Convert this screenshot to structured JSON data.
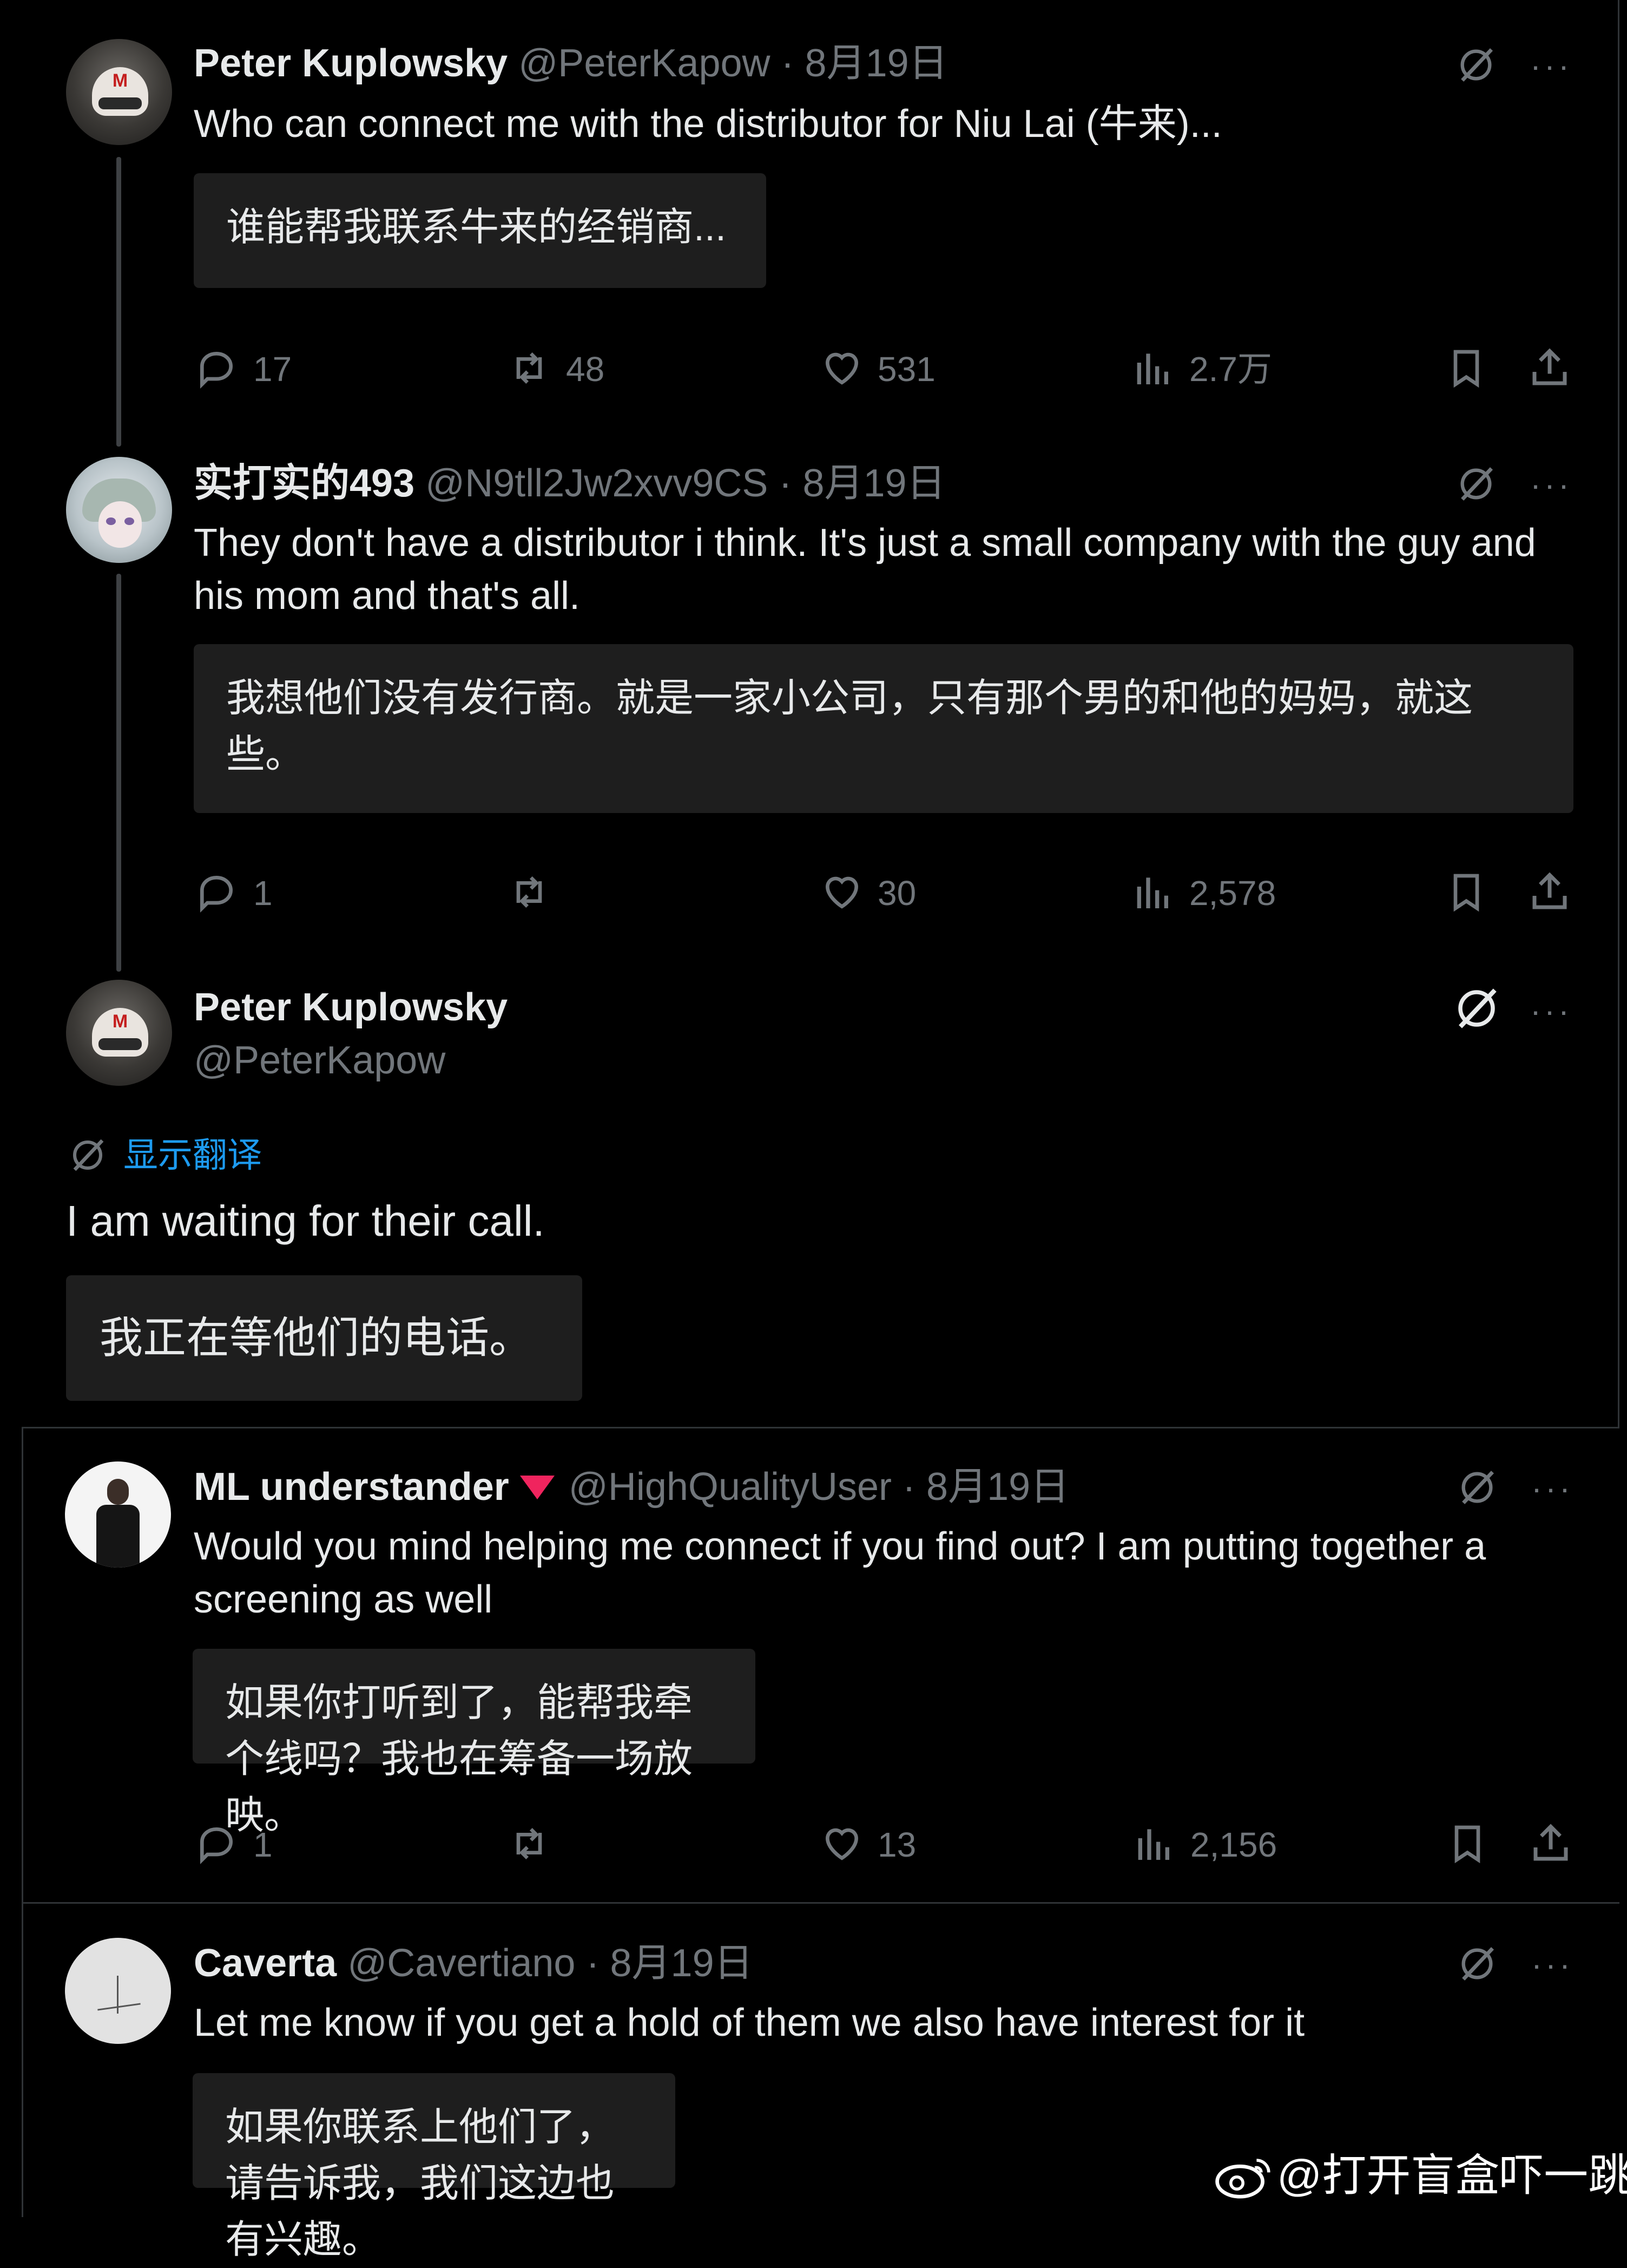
{
  "tweets": [
    {
      "name": "Peter Kuplowsky",
      "handle": "@PeterKapow",
      "sep": "·",
      "date": "8月19日",
      "text": "Who can connect me with the distributor for Niu Lai (牛来)...",
      "translation": "谁能帮我联系牛来的经销商...",
      "replies": "17",
      "retweets": "48",
      "likes": "531",
      "views": "2.7万"
    },
    {
      "name": "实打实的493",
      "handle": "@N9tll2Jw2xvv9CS",
      "sep": "·",
      "date": "8月19日",
      "text": "They don't have a distributor i think. It's just a small company with the guy and his mom and that's all.",
      "translation": "我想他们没有发行商。就是一家小公司，只有那个男的和他的妈妈，就这些。",
      "replies": "1",
      "retweets": "",
      "likes": "30",
      "views": "2,578"
    },
    {
      "name": "Peter Kuplowsky",
      "handle": "@PeterKapow",
      "show_translation": "显示翻译",
      "text": "I am waiting for their call.",
      "translation": "我正在等他们的电话。"
    },
    {
      "name": "ML understander",
      "handle": "@HighQualityUser",
      "sep": "·",
      "date": "8月19日",
      "text": "Would you mind helping me connect if you find out? I am putting together a screening as well",
      "translation": "如果你打听到了，能帮我牵个线吗？我也在筹备一场放映。",
      "replies": "1",
      "retweets": "",
      "likes": "13",
      "views": "2,156"
    },
    {
      "name": "Caverta",
      "handle": "@Cavertiano",
      "sep": "·",
      "date": "8月19日",
      "text": "Let me know if you get a hold of them we also have interest for it",
      "translation": "如果你联系上他们了，请告诉我，我们这边也有兴趣。"
    }
  ],
  "more_label": "···",
  "watermark": "@打开盲盒吓一跳",
  "colors": {
    "background": "#000000",
    "text": "#e7e9ea",
    "muted": "#71767b",
    "link": "#1d9bf0",
    "box": "#1e1e1e",
    "badge": "#f0245e"
  }
}
